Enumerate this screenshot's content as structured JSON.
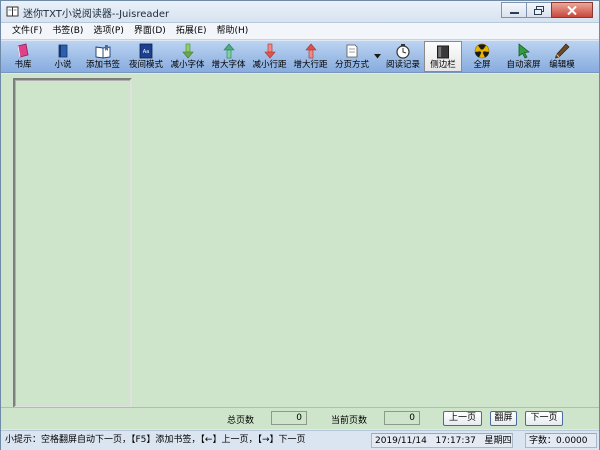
{
  "window": {
    "title": "迷你TXT小说阅读器--Juisreader"
  },
  "menu": [
    "文件(F)",
    "书签(B)",
    "选项(P)",
    "界面(D)",
    "拓展(E)",
    "帮助(H)"
  ],
  "toolbar": [
    {
      "label": "书库",
      "icon": "bookcase-icon",
      "color": "#e0408a"
    },
    {
      "label": "小说",
      "icon": "novel-book-icon",
      "color": "#2d5fb0"
    },
    {
      "label": "添加书签",
      "icon": "add-bookmark-icon",
      "color": "#3f6fae"
    },
    {
      "label": "夜间模式",
      "icon": "night-mode-icon",
      "color": "#1d3f8f"
    },
    {
      "label": "减小字体",
      "icon": "font-decrease-icon",
      "color": "#6aa84f"
    },
    {
      "label": "增大字体",
      "icon": "font-increase-icon",
      "color": "#4caf7d"
    },
    {
      "label": "减小行距",
      "icon": "line-spacing-decrease-icon",
      "color": "#e0554f"
    },
    {
      "label": "增大行距",
      "icon": "line-spacing-increase-icon",
      "color": "#d9534f"
    },
    {
      "label": "分页方式",
      "icon": "pagination-mode-icon",
      "color": "#555555"
    },
    {
      "label": "阅读记录",
      "icon": "reading-history-clock-icon",
      "color": "#333333"
    },
    {
      "label": "侧边栏",
      "icon": "sidebar-book-icon",
      "color": "#444444"
    },
    {
      "label": "全屏",
      "icon": "fullscreen-radiation-icon",
      "color": "#e8b400"
    },
    {
      "label": "自动滚屏",
      "icon": "auto-scroll-cursor-icon",
      "color": "#2e9e3a"
    },
    {
      "label": "编辑模",
      "icon": "edit-mode-pen-icon",
      "color": "#6b4a2a"
    }
  ],
  "navbar": {
    "total_pages_label": "总页数",
    "total_pages_value": "0",
    "current_page_label": "当前页数",
    "current_page_value": "0",
    "prev_button": "上一页",
    "flip_button": "翻屏",
    "next_button": "下一页"
  },
  "status": {
    "hint": "小提示：空格翻屏自动下一页，【F5】添加书签，【←】上一页，【→】下一页",
    "date": "2019/11/14",
    "time": "17:17:37",
    "weekday": "星期四",
    "word_count": "字数：0.0000"
  },
  "colors": {
    "reading_background": "#cfe5cb",
    "toolbar_gradient_top": "#bcd4f2",
    "toolbar_gradient_bottom": "#88ace0"
  }
}
